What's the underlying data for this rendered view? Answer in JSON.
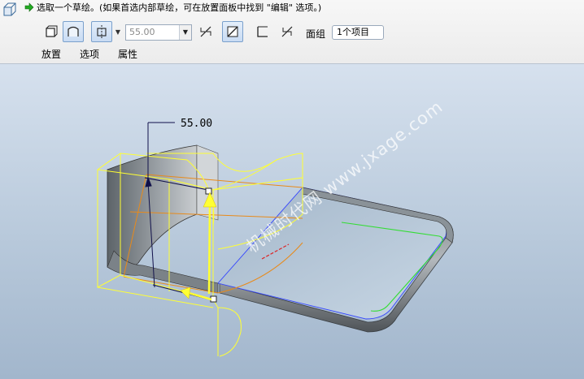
{
  "prompt": {
    "text": "选取一个草绘。(如果首选内部草绘，可在放置面板中找到 \"编辑\" 选项。)"
  },
  "toolbar": {
    "depth_value": "55.00",
    "surface_group_label": "面组",
    "surface_group_value": "1个项目"
  },
  "tabs": [
    {
      "label": "放置"
    },
    {
      "label": "选项"
    },
    {
      "label": "属性"
    }
  ],
  "viewport": {
    "dimension_label": "55.00",
    "watermark": "机械时代网 www.jxage.com"
  },
  "colors": {
    "accent_yellow": "#ffff33",
    "edge_orange": "#e88a1a",
    "edge_green": "#33dd33",
    "edge_blue": "#3344ff",
    "background_top": "#d6e1ee",
    "background_bottom": "#a2b6cc"
  }
}
